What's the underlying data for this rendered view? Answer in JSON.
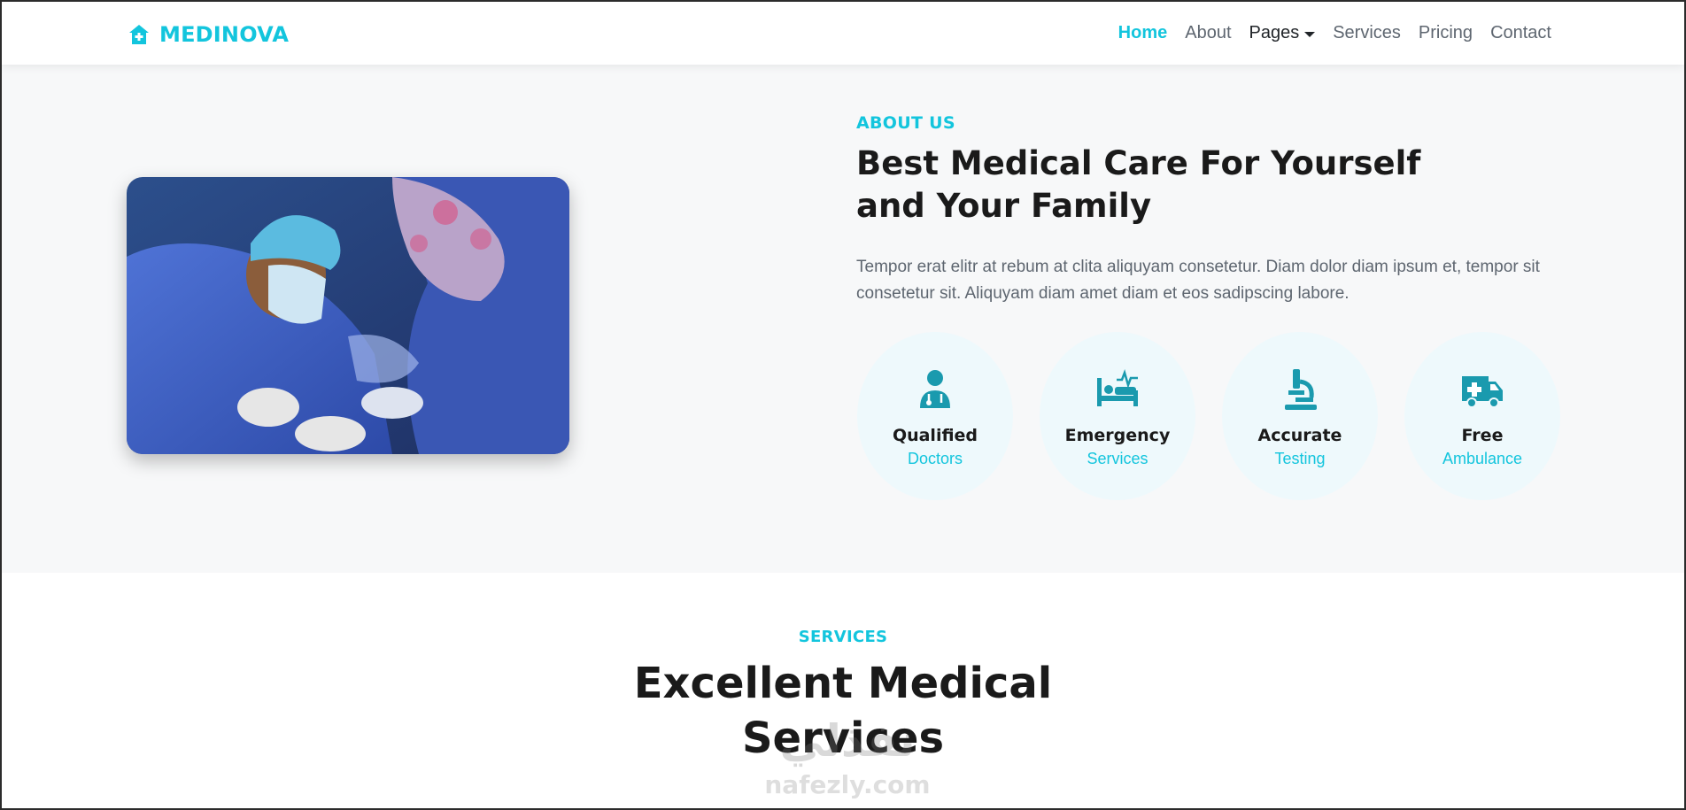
{
  "navbar": {
    "brand": "MEDINOVA",
    "links": [
      {
        "label": "Home",
        "active": true
      },
      {
        "label": "About"
      },
      {
        "label": "Pages",
        "dropdown": true
      },
      {
        "label": "Services"
      },
      {
        "label": "Pricing"
      },
      {
        "label": "Contact"
      }
    ]
  },
  "about": {
    "eyebrow": "ABOUT US",
    "title_line1": "Best Medical Care For Yourself",
    "title_line2": "and Your Family",
    "text": "Tempor erat elitr at rebum at clita aliquyam consetetur. Diam dolor diam ipsum et, tempor sit consetetur sit. Aliquyam diam amet diam et eos sadipscing labore.",
    "features": [
      {
        "icon": "doctor-icon",
        "title": "Qualified",
        "subtitle": "Doctors"
      },
      {
        "icon": "hospital-bed-icon",
        "title": "Emergency",
        "subtitle": "Services"
      },
      {
        "icon": "microscope-icon",
        "title": "Accurate",
        "subtitle": "Testing"
      },
      {
        "icon": "ambulance-icon",
        "title": "Free",
        "subtitle": "Ambulance"
      }
    ]
  },
  "services": {
    "eyebrow": "SERVICES",
    "title_line1": "Excellent Medical",
    "title_line2": "Services"
  },
  "watermark": {
    "arabic": "نفذلي",
    "latin": "nafezly.com"
  },
  "colors": {
    "accent": "#13c5dd",
    "icon": "#1a9aae",
    "section_bg": "#f7f8f9",
    "feature_bg": "#eef9fc"
  }
}
